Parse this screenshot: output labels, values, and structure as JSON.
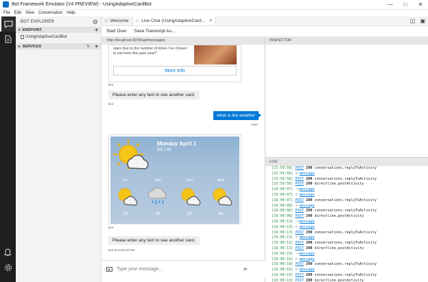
{
  "window": {
    "title": "Bot Framework Emulator (V4 PREVIEW) - UsingAdaptiveCardBot"
  },
  "menu": [
    "File",
    "Edit",
    "View",
    "Conversation",
    "Help"
  ],
  "explorer": {
    "title": "BOT EXPLORER",
    "endpoint_header": "ENDPOINT",
    "endpoint_item": "UsingAdaptiveCardBot",
    "services_header": "SERVICES"
  },
  "tabs": [
    {
      "label": "Welcome"
    },
    {
      "label": "Live Chat (UsingAdaptiveCard..."
    }
  ],
  "toolbar": {
    "start_over": "Start Over",
    "save_transcript": "Save Transcript As..."
  },
  "chat": {
    "url": "http://localhost:3978/api/messages",
    "card_quote": "stars due to the number of times I've chosen to eat here this past year!\"",
    "more_info": "More Info",
    "bot_label": "Bot",
    "bot_msg1": "Please enter any text to see another card.",
    "user_msg": "what is the weather",
    "user_label": "User",
    "weather": {
      "day": "Monday April 1",
      "temps": "63 / 42",
      "forecast": [
        {
          "day": "Fri",
          "temp": "62"
        },
        {
          "day": "Sat",
          "temp": "60"
        },
        {
          "day": "Sun",
          "temp": "59"
        },
        {
          "day": "Mon",
          "temp": "64"
        }
      ]
    },
    "bot_msg2": "Please enter any text to see another card.",
    "bot_time": "Bot at 8:00:19 PM",
    "composer_placeholder": "Type your message..."
  },
  "inspector": {
    "header": "INSPECTOR"
  },
  "log": {
    "header": "LOG",
    "lines": [
      {
        "ts": "[15:59:58]",
        "arrow": "",
        "kind": "post",
        "status": "200",
        "text": " conversations.replyToActivity"
      },
      {
        "ts": "[15:59:58]",
        "arrow": "<-",
        "kind": "message",
        "status": "",
        "text": ""
      },
      {
        "ts": "[15:59:58]",
        "arrow": "",
        "kind": "post",
        "status": "200",
        "text": " conversations.replyToActivity"
      },
      {
        "ts": "[15:59:58]",
        "arrow": "",
        "kind": "post",
        "status": "200",
        "text": " directline.postActivity"
      },
      {
        "ts": "[16:00:07]",
        "arrow": "->",
        "kind": "message",
        "status": "",
        "text": ""
      },
      {
        "ts": "[16:00:07]",
        "arrow": "<-",
        "kind": "message",
        "status": "",
        "text": ""
      },
      {
        "ts": "[16:00:07]",
        "arrow": "",
        "kind": "post",
        "status": "200",
        "text": " conversations.replyToActivity"
      },
      {
        "ts": "[16:00:08]",
        "arrow": "<-",
        "kind": "message",
        "status": "",
        "text": ""
      },
      {
        "ts": "[16:00:08]",
        "arrow": "",
        "kind": "post",
        "status": "200",
        "text": " conversations.replyToActivity"
      },
      {
        "ts": "[16:00:08]",
        "arrow": "",
        "kind": "post",
        "status": "200",
        "text": " directline.postActivity"
      },
      {
        "ts": "[16:00:13]",
        "arrow": "->",
        "kind": "message",
        "status": "",
        "text": ""
      },
      {
        "ts": "[16:00:13]",
        "arrow": "<-",
        "kind": "message",
        "status": "",
        "text": ""
      },
      {
        "ts": "[16:00:13]",
        "arrow": "",
        "kind": "post",
        "status": "200",
        "text": " conversations.replyToActivity"
      },
      {
        "ts": "[16:00:13]",
        "arrow": "<-",
        "kind": "message",
        "status": "",
        "text": ""
      },
      {
        "ts": "[16:00:13]",
        "arrow": "",
        "kind": "post",
        "status": "200",
        "text": " conversations.replyToActivity"
      },
      {
        "ts": "[16:00:13]",
        "arrow": "",
        "kind": "post",
        "status": "200",
        "text": " directline.postActivity"
      },
      {
        "ts": "[16:00:19]",
        "arrow": "->",
        "kind": "message",
        "status": "",
        "text": ""
      },
      {
        "ts": "[16:00:19]",
        "arrow": "<-",
        "kind": "message",
        "status": "",
        "text": ""
      },
      {
        "ts": "[16:00:19]",
        "arrow": "",
        "kind": "post",
        "status": "200",
        "text": " conversations.replyToActivity"
      },
      {
        "ts": "[16:00:19]",
        "arrow": "<-",
        "kind": "message",
        "status": "",
        "text": ""
      },
      {
        "ts": "[16:00:19]",
        "arrow": "",
        "kind": "post",
        "status": "200",
        "text": " conversations.replyToActivity"
      },
      {
        "ts": "[16:00:19]",
        "arrow": "",
        "kind": "post",
        "status": "200",
        "text": " directline.postActivity"
      }
    ],
    "post_word": "POST",
    "message_word": "message"
  }
}
